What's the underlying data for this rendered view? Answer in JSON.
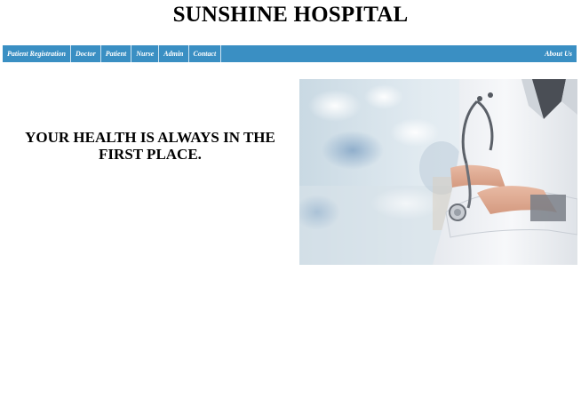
{
  "header": {
    "title": "SUNSHINE HOSPITAL"
  },
  "nav": {
    "items": [
      {
        "label": "Patient Registration"
      },
      {
        "label": "Doctor"
      },
      {
        "label": "Patient"
      },
      {
        "label": "Nurse"
      },
      {
        "label": "Admin"
      },
      {
        "label": "Contact"
      }
    ],
    "about_label": "About Us",
    "bar_color": "#3a8fc3"
  },
  "hero": {
    "tagline": "YOUR HEALTH IS ALWAYS IN THE FIRST PLACE."
  }
}
